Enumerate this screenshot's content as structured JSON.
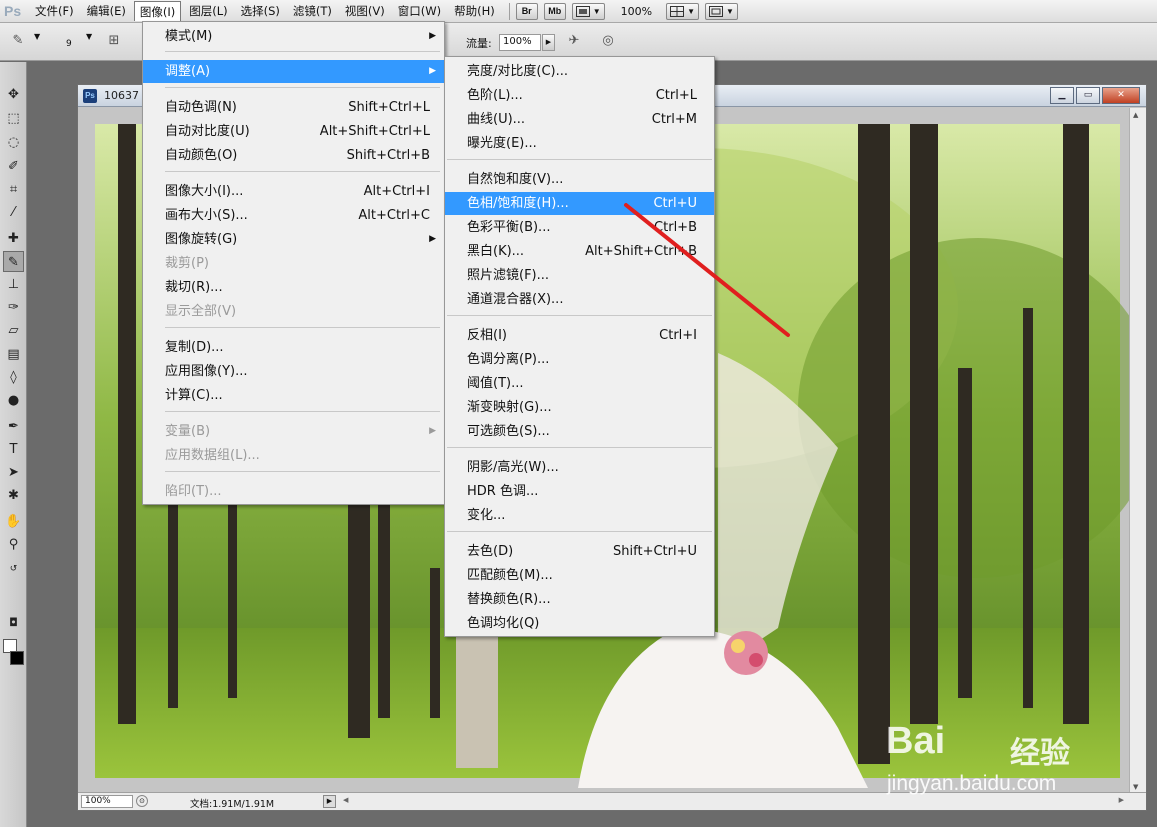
{
  "app": {
    "logo": "Ps"
  },
  "menubar": {
    "items": [
      "文件(F)",
      "编辑(E)",
      "图像(I)",
      "图层(L)",
      "选择(S)",
      "滤镜(T)",
      "视图(V)",
      "窗口(W)",
      "帮助(H)"
    ],
    "bridge_btn": "Br",
    "minibridge_btn": "Mb",
    "zoom": "100%"
  },
  "options": {
    "brush_size": "9",
    "flow_label": "流量:",
    "flow_value": "100%"
  },
  "document": {
    "title": "10637",
    "ps_badge": "Ps",
    "zoom": "100%",
    "doc_size": "文档:1.91M/1.91M"
  },
  "image_menu": {
    "items": [
      {
        "label": "模式(M)",
        "submenu": true
      },
      {
        "label": "调整(A)",
        "submenu": true,
        "highlight": true
      },
      {
        "label": "自动色调(N)",
        "shortcut": "Shift+Ctrl+L"
      },
      {
        "label": "自动对比度(U)",
        "shortcut": "Alt+Shift+Ctrl+L"
      },
      {
        "label": "自动颜色(O)",
        "shortcut": "Shift+Ctrl+B"
      },
      {
        "label": "图像大小(I)...",
        "shortcut": "Alt+Ctrl+I"
      },
      {
        "label": "画布大小(S)...",
        "shortcut": "Alt+Ctrl+C"
      },
      {
        "label": "图像旋转(G)",
        "submenu": true
      },
      {
        "label": "裁剪(P)",
        "disabled": true
      },
      {
        "label": "裁切(R)..."
      },
      {
        "label": "显示全部(V)",
        "disabled": true
      },
      {
        "label": "复制(D)..."
      },
      {
        "label": "应用图像(Y)..."
      },
      {
        "label": "计算(C)..."
      },
      {
        "label": "变量(B)",
        "submenu": true,
        "disabled": true
      },
      {
        "label": "应用数据组(L)...",
        "disabled": true
      },
      {
        "label": "陷印(T)...",
        "disabled": true
      }
    ]
  },
  "adjust_menu": {
    "items": [
      {
        "label": "亮度/对比度(C)..."
      },
      {
        "label": "色阶(L)...",
        "shortcut": "Ctrl+L"
      },
      {
        "label": "曲线(U)...",
        "shortcut": "Ctrl+M"
      },
      {
        "label": "曝光度(E)..."
      },
      {
        "label": "自然饱和度(V)..."
      },
      {
        "label": "色相/饱和度(H)...",
        "shortcut": "Ctrl+U",
        "highlight": true
      },
      {
        "label": "色彩平衡(B)...",
        "shortcut": "Ctrl+B"
      },
      {
        "label": "黑白(K)...",
        "shortcut": "Alt+Shift+Ctrl+B"
      },
      {
        "label": "照片滤镜(F)..."
      },
      {
        "label": "通道混合器(X)..."
      },
      {
        "label": "反相(I)",
        "shortcut": "Ctrl+I"
      },
      {
        "label": "色调分离(P)..."
      },
      {
        "label": "阈值(T)..."
      },
      {
        "label": "渐变映射(G)..."
      },
      {
        "label": "可选颜色(S)..."
      },
      {
        "label": "阴影/高光(W)..."
      },
      {
        "label": "HDR 色调..."
      },
      {
        "label": "变化..."
      },
      {
        "label": "去色(D)",
        "shortcut": "Shift+Ctrl+U"
      },
      {
        "label": "匹配颜色(M)..."
      },
      {
        "label": "替换颜色(R)..."
      },
      {
        "label": "色调均化(Q)"
      }
    ]
  },
  "watermark": {
    "logo": "Bai",
    "cn": "经验",
    "url": "jingyan.baidu.com"
  },
  "colors": {
    "highlight": "#3399ff",
    "annotation_arrow": "#e01f1f"
  }
}
